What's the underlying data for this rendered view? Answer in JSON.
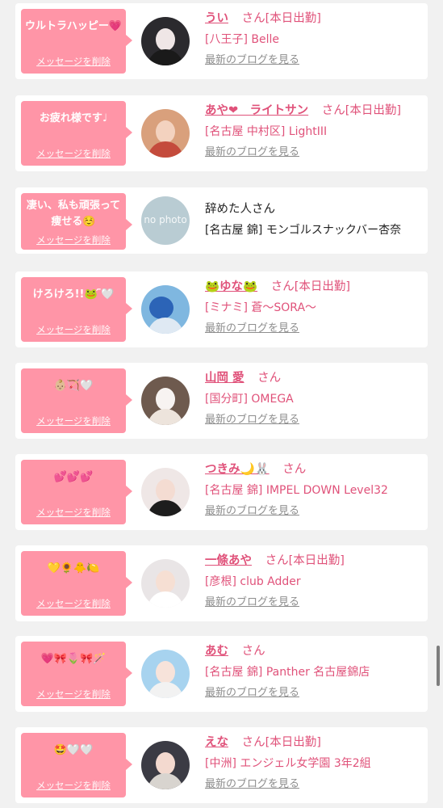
{
  "entries": [
    {
      "message": "ウルトラハッピー💗",
      "delete_label": "メッセージを削除",
      "name": "うい",
      "suffix": "さん[本日出勤]",
      "shop": "[八王子] Belle",
      "blog_label": "最新のブログを見る",
      "avatar_bg": "#2b2a2e",
      "avatar_body": "#1a1a1a",
      "active": true
    },
    {
      "message": "お疲れ様です♩",
      "delete_label": "メッセージを削除",
      "name": "あや❤︎　ライトサン",
      "suffix": "さん[本日出勤]",
      "shop": "[名古屋 中村区] LightIII",
      "blog_label": "最新のブログを見る",
      "avatar_bg": "#d9a07c",
      "avatar_body": "#c44b3c",
      "active": true
    },
    {
      "message": "凄い、私も頑張って痩せる☺️",
      "delete_label": "メッセージを削除",
      "name": "辞めた人",
      "suffix": "さん",
      "shop": "[名古屋 錦] モンゴルスナックバー杏奈",
      "blog_label": "",
      "avatar_bg": "#b9ccd3",
      "avatar_body": "#a5bcc4",
      "avatar_text": "no photo",
      "active": false
    },
    {
      "message": "けろけろ!!🐸 ᷇🤍",
      "delete_label": "メッセージを削除",
      "name": "🐸ゆな🐸",
      "suffix": "さん[本日出勤]",
      "shop": "[ミナミ] 蒼〜SORA〜",
      "blog_label": "最新のブログを見る",
      "avatar_bg": "#7fb7e0",
      "avatar_body": "#2c64b7",
      "active": true
    },
    {
      "message": "👶🏼🏹🤍",
      "delete_label": "メッセージを削除",
      "name": "山岡 愛",
      "suffix": "さん",
      "shop": "[国分町] OMEGA",
      "blog_label": "最新のブログを見る",
      "avatar_bg": "#6e5a4e",
      "avatar_body": "#ede4dc",
      "active": true
    },
    {
      "message": "💕💕💕",
      "delete_label": "メッセージを削除",
      "name": "つきみ🌙🐰",
      "suffix": "さん",
      "shop": "[名古屋 錦] IMPEL DOWN Level32",
      "blog_label": "最新のブログを見る",
      "avatar_bg": "#efe7e6",
      "avatar_body": "#1d1d1d",
      "active": true
    },
    {
      "message": "💛🌻🐥🍋",
      "delete_label": "メッセージを削除",
      "name": "一條あや",
      "suffix": "さん[本日出勤]",
      "shop": "[彦根] club Adder",
      "blog_label": "最新のブログを見る",
      "avatar_bg": "#e9e5e6",
      "avatar_body": "#ffffff",
      "active": true
    },
    {
      "message": "💗🎀🌷🎀🪄",
      "delete_label": "メッセージを削除",
      "name": "あむ",
      "suffix": "さん",
      "shop": "[名古屋 錦] Panther 名古屋錦店",
      "blog_label": "最新のブログを見る",
      "avatar_bg": "#a7d3ef",
      "avatar_body": "#f2f2f2",
      "active": true
    },
    {
      "message": "🤩🤍🤍",
      "delete_label": "メッセージを削除",
      "name": "えな",
      "suffix": "さん[本日出勤]",
      "shop": "[中洲] エンジェル女学園 3年2組",
      "blog_label": "最新のブログを見る",
      "avatar_bg": "#3b3b44",
      "avatar_body": "#d8d4cf",
      "active": true
    }
  ]
}
